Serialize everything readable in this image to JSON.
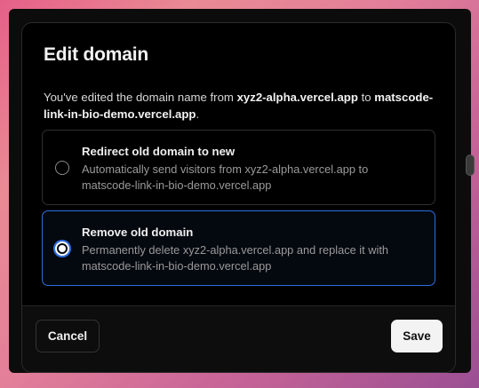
{
  "modal": {
    "title": "Edit domain",
    "description": {
      "prefix": "You've edited the domain name from ",
      "old_domain": "xyz2-alpha.vercel.app",
      "middle": " to ",
      "new_domain": "matscode-link-in-bio-demo.vercel.app",
      "suffix": "."
    },
    "options": [
      {
        "title": "Redirect old domain to new",
        "description": "Automatically send visitors from xyz2-alpha.vercel.app to matscode-link-in-bio-demo.vercel.app",
        "selected": false
      },
      {
        "title": "Remove old domain",
        "description": "Permanently delete xyz2-alpha.vercel.app and replace it with matscode-link-in-bio-demo.vercel.app",
        "selected": true
      }
    ],
    "footer": {
      "cancel_label": "Cancel",
      "save_label": "Save"
    }
  },
  "colors": {
    "accent_blue": "#2d6ee0",
    "modal_bg": "#000000",
    "text_primary": "#efefef",
    "text_muted": "#9a9a9a"
  }
}
